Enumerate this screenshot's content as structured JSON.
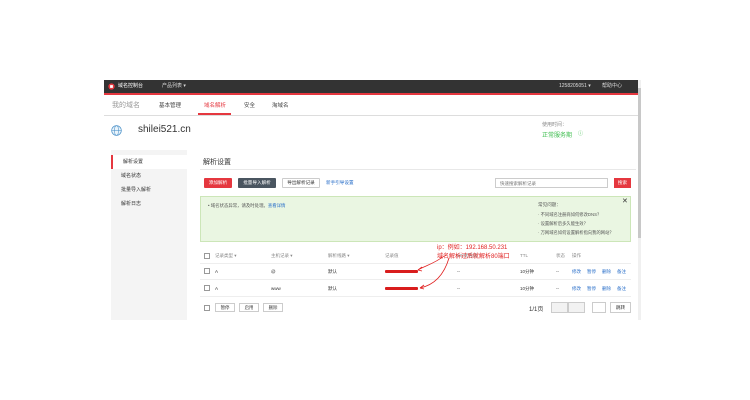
{
  "header": {
    "logo_text": "域名控制台",
    "product_menu": "产品列表",
    "account": "1258205051",
    "help": "帮助中心"
  },
  "nav": {
    "my_domain": "我的域名",
    "tabs": [
      "基本管理",
      "域名解析",
      "安全",
      "淘域名"
    ],
    "active_tab": "域名解析"
  },
  "domain": {
    "name": "shilei521.cn",
    "status_label": "使用时间：",
    "status_value": "正常服务期"
  },
  "sidebar": {
    "items": [
      "解析设置",
      "域名状态",
      "批量导入解析",
      "解析日志"
    ],
    "active": "解析设置"
  },
  "main": {
    "title": "解析设置",
    "buttons": {
      "add": "添加解析",
      "batch_import": "批量导入解析",
      "export": "导出解析记录",
      "guide": "新手引导设置"
    },
    "search_placeholder": "快速搜索解析记录",
    "search_button": "搜索"
  },
  "notice": {
    "text": "域名状态异常，请及时处理。",
    "link": "查看详情",
    "help_title": "常见问题：",
    "help_items": [
      "· 不同域名注册商如何修改DNS？",
      "· 设置解析后多久能生效？",
      "· 万网域名如何设置解析指向我的网站？"
    ]
  },
  "table": {
    "headers": [
      "记录类型 ▾",
      "主机记录 ▾",
      "解析线路 ▾",
      "记录值",
      "MX优先级",
      "TTL",
      "状态",
      "操作"
    ],
    "rows": [
      {
        "type": "A",
        "host": "@",
        "line": "默认",
        "mx": "--",
        "ttl": "10分钟",
        "status": "--",
        "ops": [
          "修改",
          "暂停",
          "删除",
          "备注"
        ]
      },
      {
        "type": "A",
        "host": "www",
        "line": "默认",
        "mx": "--",
        "ttl": "10分钟",
        "status": "--",
        "ops": [
          "修改",
          "暂停",
          "删除",
          "备注"
        ]
      }
    ]
  },
  "footer": {
    "pause": "暂停",
    "enable": "启用",
    "delete": "删除",
    "page_info": "1/1页",
    "jump": "跳转"
  },
  "annotation": {
    "line1": "ip：例如：192.168.50.231",
    "line2": "域名解析过后就解析80端口"
  },
  "colors": {
    "accent": "#e5373f",
    "topbar": "#333333",
    "link": "#2a6fc9",
    "ok": "#3dbd4e",
    "notice_bg": "#eaf6e2"
  }
}
